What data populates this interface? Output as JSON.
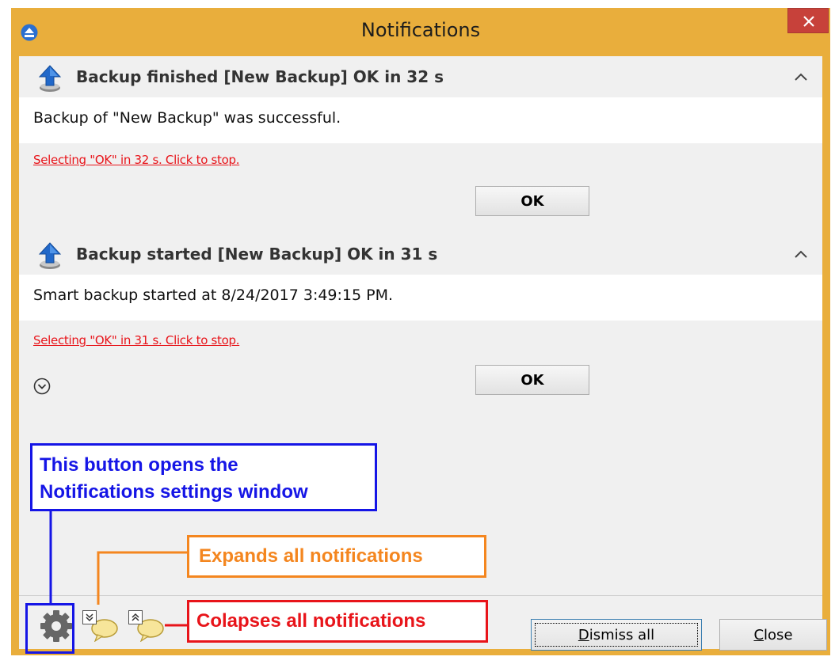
{
  "window": {
    "title": "Notifications",
    "close_glyph": "✕",
    "frame_color": "#e9ae3c"
  },
  "notifications": [
    {
      "icon": "upload-arrow-icon",
      "title": "Backup finished [New Backup] OK in 32 s",
      "message": "Backup of \"New Backup\" was successful.",
      "auto_action_link": "Selecting \"OK\" in 32 s. Click to stop.",
      "ok_label": "OK"
    },
    {
      "icon": "upload-arrow-icon",
      "title": "Backup started [New Backup] OK in 31 s",
      "message": "Smart backup started at 8/24/2017 3:49:15 PM.",
      "auto_action_link": "Selecting \"OK\" in 31 s. Click to stop.",
      "ok_label": "OK"
    }
  ],
  "footer": {
    "dismiss_all": {
      "mnemonic": "D",
      "rest": "ismiss all"
    },
    "close": {
      "mnemonic": "C",
      "rest": "lose"
    }
  },
  "annotations": {
    "settings": {
      "line1": "This button opens the",
      "line2": "Notifications settings window",
      "color": "#1515e6"
    },
    "expand": {
      "text": "Expands all notifications",
      "color": "#f4861f"
    },
    "collapse": {
      "text": "Colapses all notifications",
      "color": "#e8141a"
    }
  },
  "colors": {
    "link": "#e8141a",
    "close_button": "#c7413a",
    "app_icon": "#2a6fd0"
  }
}
